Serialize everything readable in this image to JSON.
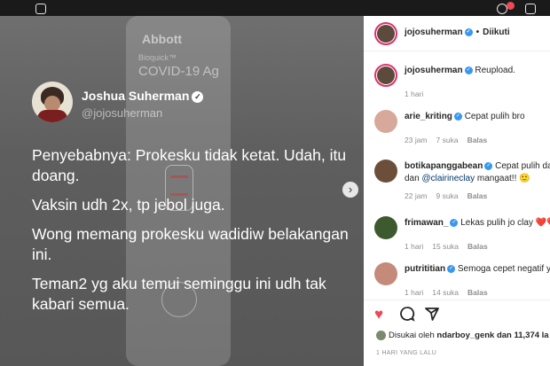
{
  "post": {
    "test_brand": "Abbott",
    "test_product": "Bioquick™",
    "test_name": "COVID-19 Ag",
    "tweet": {
      "name": "Joshua Suherman",
      "handle": "@jojosuherman",
      "paragraphs": [
        "Penyebabnya: Prokesku tidak ketat. Udah, itu doang.",
        "Vaksin udh 2x, tp jebol juga.",
        "Wong memang prokesku wadidiw belakangan ini.",
        "Teman2 yg aku temui seminggu ini udh tak kabari semua."
      ]
    }
  },
  "sidebar": {
    "header": {
      "username": "jojosuherman",
      "follow_status": "Diikuti"
    },
    "comments": [
      {
        "user": "jojosuherman",
        "text": "Reupload.",
        "time": "1 hari",
        "likes": "",
        "reply": ""
      },
      {
        "user": "arie_kriting",
        "text": "Cepat pulih bro",
        "time": "23 jam",
        "likes": "7 suka",
        "reply": "Balas"
      },
      {
        "user": "botikapanggabean",
        "text": "Cepat pulih da",
        "text2_prefix": "dan ",
        "mention": "@clairineclay",
        "text2_suffix": " mangaat!! 🙂",
        "time": "22 jam",
        "likes": "9 suka",
        "reply": "Balas"
      },
      {
        "user": "frimawan_",
        "text": "Lekas pulih jo clay ❤️❤️",
        "time": "1 hari",
        "likes": "15 suka",
        "reply": "Balas"
      },
      {
        "user": "putrititian",
        "text": "Semoga cepet negatif y",
        "time": "1 hari",
        "likes": "14 suka",
        "reply": "Balas"
      }
    ],
    "liked_by": {
      "prefix": "Disukai oleh ",
      "user": "ndarboy_genk",
      "suffix": " dan 11,374 la"
    },
    "timestamp": "1 HARI YANG LALU"
  },
  "icons": [
    "home-icon",
    "messenger-icon",
    "new-post-icon",
    "explore-icon",
    "activity-icon",
    "heart-icon",
    "comment-icon",
    "share-icon",
    "verified-icon",
    "next-arrow-icon",
    "more-options-icon"
  ],
  "colors": {
    "like_red": "#ed4956",
    "verified_blue": "#3897f0",
    "text_dark": "#262626",
    "text_muted": "#8e8e8e"
  }
}
